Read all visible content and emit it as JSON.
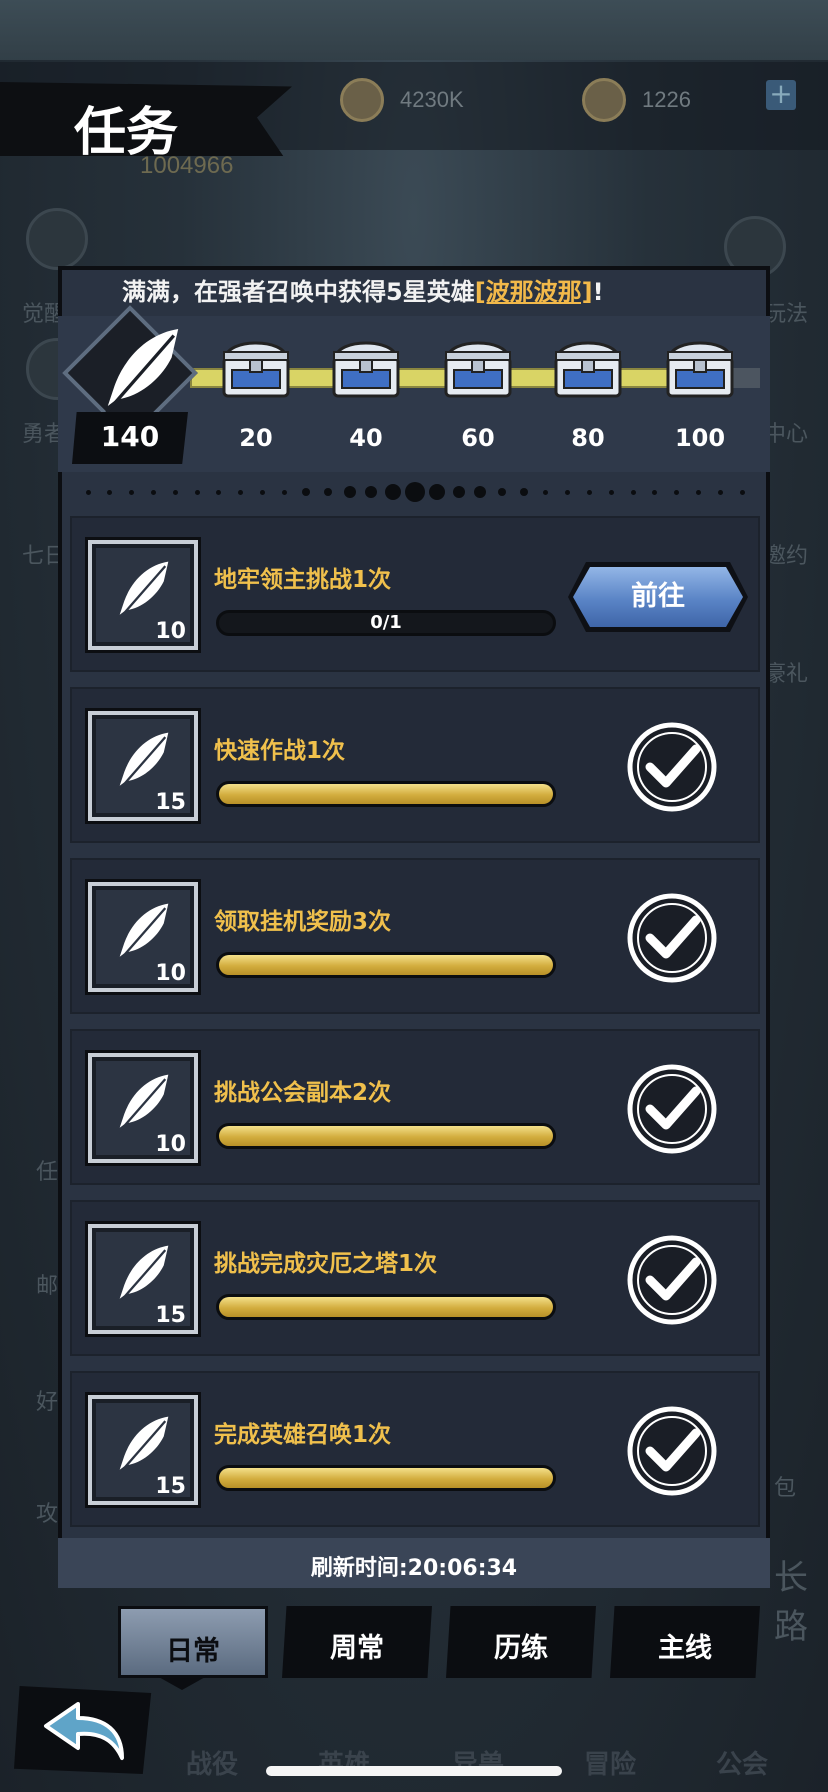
{
  "colors": {
    "accent_gold": "#f0c04c",
    "hero_name": "#f2b94a",
    "progress_gold": "#d2ad3e",
    "go_button_blue": "#5a84c6",
    "panel_bg": "#2a3342"
  },
  "resources": {
    "gold_icon": "gold-coin-icon",
    "gold": "4230K",
    "gem_icon": "gem-bag-icon",
    "gems": "1226",
    "plus_icon": "plus-icon",
    "power": "1004966"
  },
  "page_title": "任务",
  "ticker": {
    "prefix": "满满，在强者召唤中获得5星英雄",
    "hero": "[波那波那]",
    "suffix": "!"
  },
  "progress": {
    "current_points": "140",
    "milestones": [
      "20",
      "40",
      "60",
      "80",
      "100"
    ]
  },
  "tasks": [
    {
      "name": "地牢领主挑战1次",
      "points": "10",
      "progress": 0,
      "progress_text": "0/1",
      "status": "go",
      "button": "前往"
    },
    {
      "name": "快速作战1次",
      "points": "15",
      "progress": 1,
      "status": "done"
    },
    {
      "name": "领取挂机奖励3次",
      "points": "10",
      "progress": 1,
      "status": "done"
    },
    {
      "name": "挑战公会副本2次",
      "points": "10",
      "progress": 1,
      "status": "done"
    },
    {
      "name": "挑战完成灾厄之塔1次",
      "points": "15",
      "progress": 1,
      "status": "done"
    },
    {
      "name": "完成英雄召唤1次",
      "points": "15",
      "progress": 1,
      "status": "done"
    }
  ],
  "refresh_text": "刷新时间:20:06:34",
  "tabs": [
    {
      "label": "日常",
      "active": true
    },
    {
      "label": "周常"
    },
    {
      "label": "历练"
    },
    {
      "label": "主线"
    }
  ],
  "back_icon": "return-arrow-icon",
  "background": {
    "left_labels": [
      "觉醒",
      "勇者",
      "七日",
      "任",
      "邮",
      "好",
      "攻"
    ],
    "right_labels": [
      "玩法",
      "中心",
      "邀约",
      "豪礼",
      "包",
      "长路"
    ],
    "bottom_nav": [
      "战役",
      "英雄",
      "异兽",
      "冒险",
      "公会"
    ]
  }
}
